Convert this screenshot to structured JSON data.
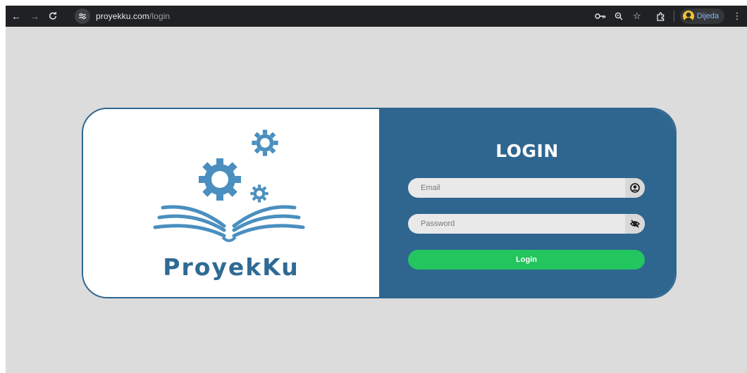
{
  "browser": {
    "url_host": "proyekku.com",
    "url_path": "/login",
    "profile_name": "Dijeda"
  },
  "brand": {
    "name": "ProyekKu",
    "color": "#2e6a94"
  },
  "login": {
    "title": "LOGIN",
    "email_placeholder": "Email",
    "password_placeholder": "Password",
    "button_label": "Login"
  },
  "colors": {
    "panel": "#2e6690",
    "button": "#22c55e",
    "page_bg": "#dcdcdc"
  },
  "icons": {
    "email": "user-circle-icon",
    "password": "eye-off-icon"
  }
}
